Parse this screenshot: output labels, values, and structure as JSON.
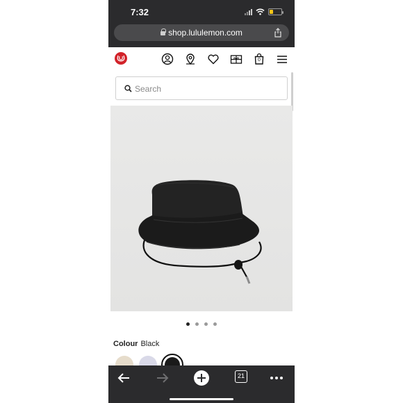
{
  "status": {
    "time": "7:32"
  },
  "browser": {
    "url": "shop.lululemon.com",
    "tab_count": "21"
  },
  "header": {
    "bag_count": "0"
  },
  "search": {
    "placeholder": "Search",
    "value": ""
  },
  "product": {
    "image_alt": "Black bucket hat with drawcord",
    "carousel": {
      "total": 4,
      "active": 1
    },
    "colour_label": "Colour",
    "colour_value": "Black",
    "swatches": [
      {
        "name": "beige",
        "color": "#e6dccb"
      },
      {
        "name": "lavender",
        "color": "#d9d9e8"
      },
      {
        "name": "black",
        "color": "#1a1a1a",
        "selected": true
      }
    ]
  },
  "colors": {
    "chrome": "#2b2b2d",
    "brand_red": "#d2232a"
  },
  "icons": [
    "lululemon-logo-icon",
    "account-icon",
    "store-locator-icon",
    "wishlist-heart-icon",
    "gift-card-icon",
    "shopping-bag-icon",
    "menu-icon",
    "search-icon",
    "share-icon",
    "back-arrow-icon",
    "forward-arrow-icon",
    "new-tab-plus-icon",
    "tabs-icon",
    "more-icon"
  ]
}
